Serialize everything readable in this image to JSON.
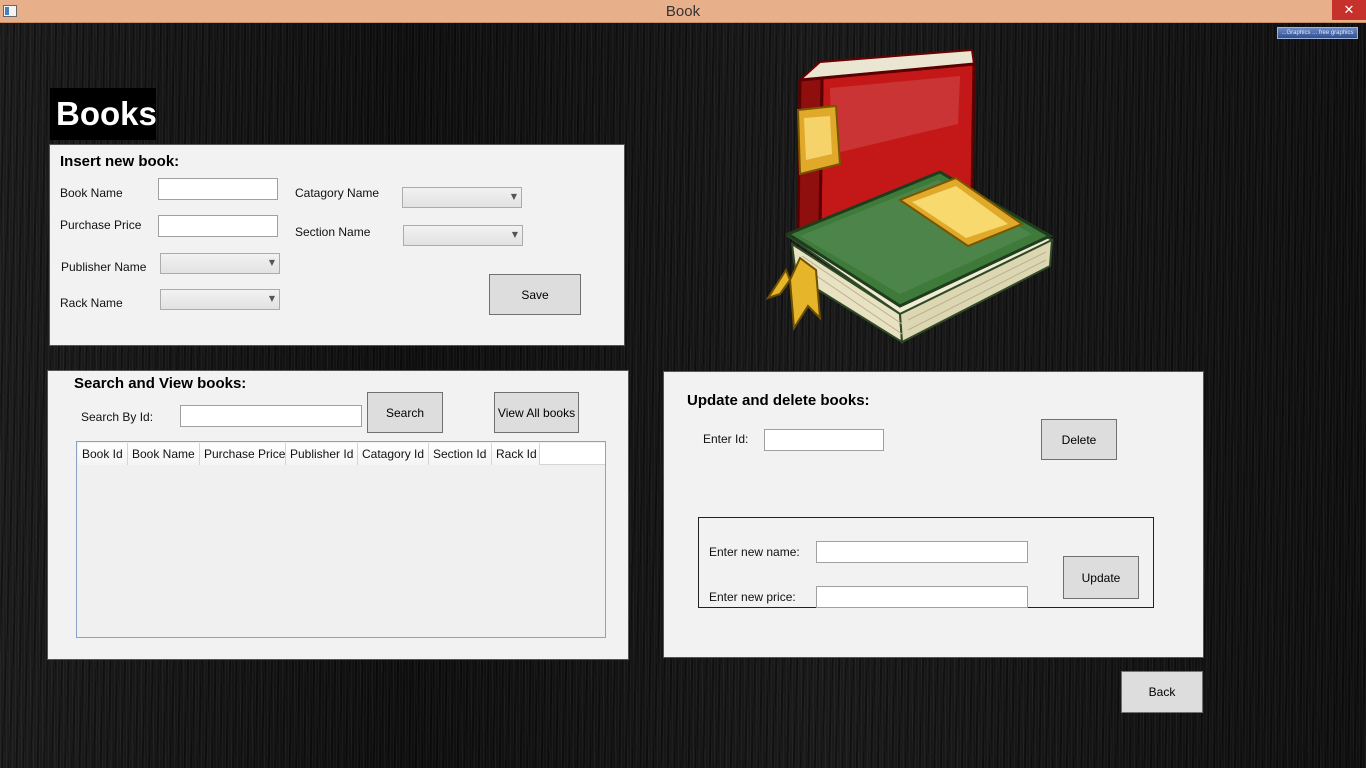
{
  "window": {
    "title": "Book",
    "close_glyph": "✕",
    "watermark_text": "...Graphics ... free graphics"
  },
  "heading": "Books",
  "insert_panel": {
    "title": "Insert new book:",
    "book_name_label": "Book Name",
    "book_name_value": "",
    "purchase_price_label": "Purchase Price",
    "purchase_price_value": "",
    "publisher_name_label": "Publisher Name",
    "rack_name_label": "Rack Name",
    "category_name_label": "Catagory Name",
    "section_name_label": "Section Name",
    "save_label": "Save"
  },
  "search_panel": {
    "title": "Search and View books:",
    "search_by_id_label": "Search By Id:",
    "search_value": "",
    "search_label": "Search",
    "view_all_label": "View All books",
    "columns": [
      "Book Id",
      "Book Name",
      "Purchase Price",
      "Publisher Id",
      "Catagory Id",
      "Section Id",
      "Rack Id"
    ]
  },
  "update_panel": {
    "title": "Update and delete books:",
    "enter_id_label": "Enter Id:",
    "enter_id_value": "",
    "delete_label": "Delete",
    "new_name_label": "Enter new name:",
    "new_name_value": "",
    "new_price_label": "Enter new price:",
    "new_price_value": "",
    "update_label": "Update"
  },
  "back_label": "Back",
  "icons": {
    "books_illustration": "books-icon",
    "dropdown_arrow": "chevron-down-icon"
  },
  "colors": {
    "titlebar": "#e8b08a",
    "panel": "#f2f2f2",
    "button": "#dddddd",
    "red_book": "#b01818",
    "green_book": "#3d6e3a"
  }
}
